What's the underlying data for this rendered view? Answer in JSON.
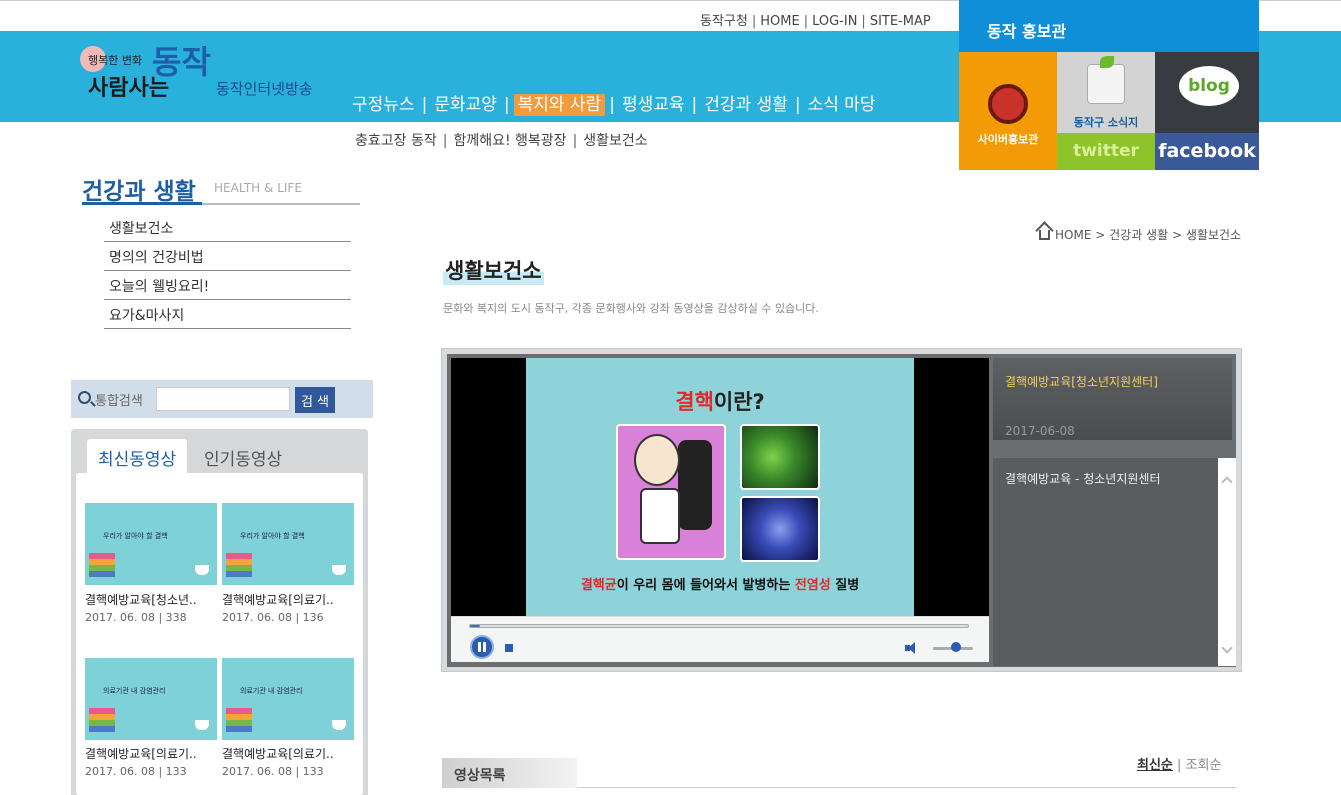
{
  "utility": {
    "links": [
      "동작구청",
      "HOME",
      "LOG-IN",
      "SITE-MAP"
    ]
  },
  "logo": {
    "line1": "행복한 변화",
    "line2": "사람사는",
    "big": "동작",
    "sub": "동작인터넷방송"
  },
  "gnb": {
    "items": [
      "구정뉴스",
      "문화교양",
      "복지와 사람",
      "평생교육",
      "건강과 생활",
      "소식 마당"
    ],
    "active_index": 2
  },
  "subnav": {
    "items": [
      "충효고장 동작",
      "함께해요! 행복광장",
      "생활보건소"
    ]
  },
  "promo": {
    "title": "동작 홍보관",
    "tiles": {
      "cyber": "사이버홍보관",
      "news": "동작구 소식지",
      "blog": "blog",
      "twitter": "twitter",
      "facebook": "facebook"
    }
  },
  "lnb": {
    "title": "건강과 생활",
    "title_en": "HEALTH & LIFE",
    "items": [
      "생활보건소",
      "명의의 건강비법",
      "오늘의 웰빙요리!",
      "요가&마사지"
    ]
  },
  "search": {
    "label": "통합검색",
    "value": "",
    "button": "검 색"
  },
  "video_tabs": {
    "latest": "최신동영상",
    "popular": "인기동영상",
    "items": [
      {
        "thumb_title": "우리가 알아야 할 결핵",
        "title": "결핵예방교육[청소년..",
        "meta": "2017. 06. 08 | 338"
      },
      {
        "thumb_title": "우리가 알아야 할 결핵",
        "title": "결핵예방교육[의료기..",
        "meta": "2017. 06. 08 | 136"
      },
      {
        "thumb_title": "의료기관 내 감염관리",
        "title": "결핵예방교육[의료기..",
        "meta": "2017. 06. 08 | 133"
      },
      {
        "thumb_title": "의료기관 내 감염관리",
        "title": "결핵예방교육[의료기..",
        "meta": "2017. 06. 08 | 133"
      }
    ]
  },
  "breadcrumb": {
    "home": "HOME",
    "level1": "건강과 생활",
    "level2": "생활보건소",
    "sep": ">"
  },
  "page": {
    "title": "생활보건소",
    "desc": "문화와 복지의 도시 동작구, 각종 문화행사와 강좌 동영상을 감상하실 수 있습니다."
  },
  "player": {
    "slide_title_red": "결핵",
    "slide_title_rest": "이란?",
    "caption_red1": "결핵균",
    "caption_mid": "이 우리 몸에 들어와서 발병하는 ",
    "caption_red2": "전염성",
    "caption_end": " 질병",
    "progress": 0.02,
    "info_title": "결핵예방교육[청소년지원센터]",
    "info_date": "2017-06-08",
    "description": "결핵예방교육 - 청소년지원센터"
  },
  "list": {
    "label": "영상목록",
    "sort_latest": "최신순",
    "sort_sep": "|",
    "sort_views": "조회순"
  }
}
